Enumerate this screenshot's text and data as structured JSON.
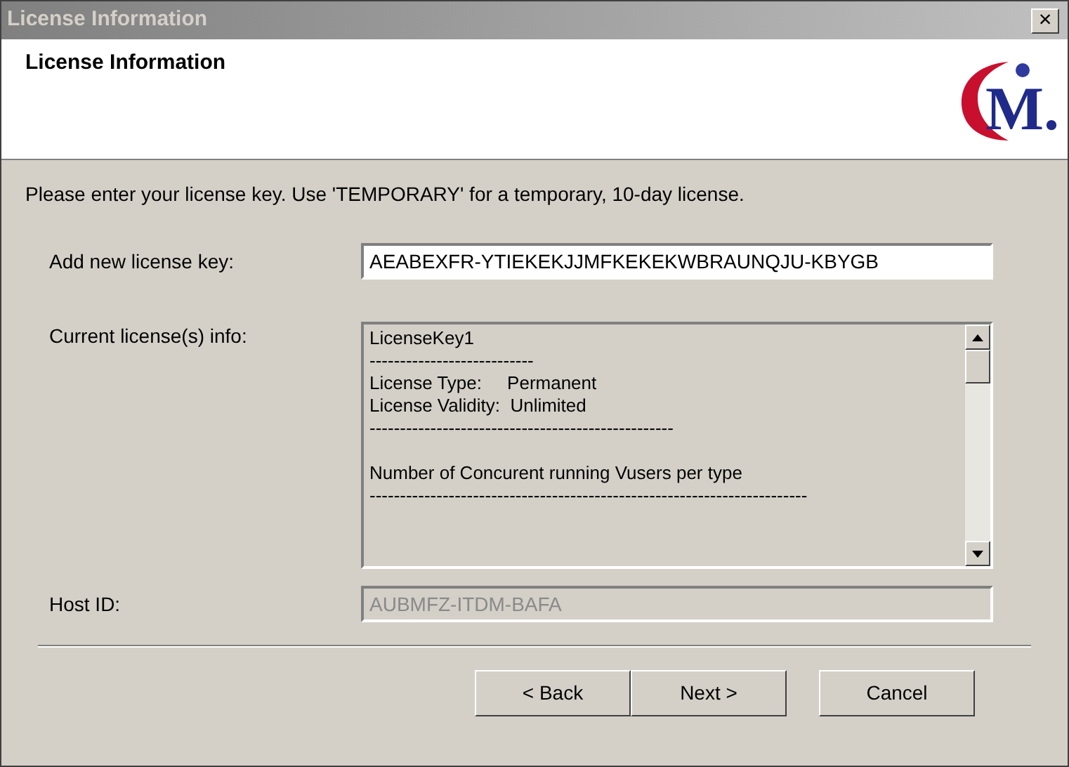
{
  "window": {
    "title": "License Information",
    "close": "×",
    "active": false
  },
  "header": {
    "title": "License Information",
    "logo": "M."
  },
  "instruction": "Please enter your license key. Use 'TEMPORARY' for a temporary, 10-day license.",
  "fields": [
    {
      "kind": "input",
      "label": "Add new license key:",
      "value": "AEABEXFR-YTIEKEKJJMFKEKEKWBRAUNQJU-KBYGB",
      "disabled": false
    },
    {
      "kind": "textarea",
      "label": "Current license(s) info:",
      "lines": [
        {
          "kind": "text",
          "text": "LicenseKey1"
        },
        {
          "kind": "text",
          "text": "---------------------------"
        },
        {
          "kind": "text",
          "text": "License Type:     Permanent"
        },
        {
          "kind": "text",
          "text": "License Validity:  Unlimited"
        },
        {
          "kind": "text",
          "text": "--------------------------------------------------"
        },
        {
          "kind": "blank"
        },
        {
          "kind": "text",
          "text": "Number of Concurent running Vusers per type"
        },
        {
          "kind": "text",
          "text": "------------------------------------------------------------------------"
        }
      ]
    },
    {
      "kind": "input",
      "label": "Host ID:",
      "value": "AUBMFZ-ITDM-BAFA",
      "disabled": true
    }
  ],
  "buttons": [
    {
      "label": "< Back",
      "kind": "nav"
    },
    {
      "label": "Next >",
      "kind": "nav"
    },
    {
      "label": "Cancel",
      "kind": "cancel"
    }
  ]
}
